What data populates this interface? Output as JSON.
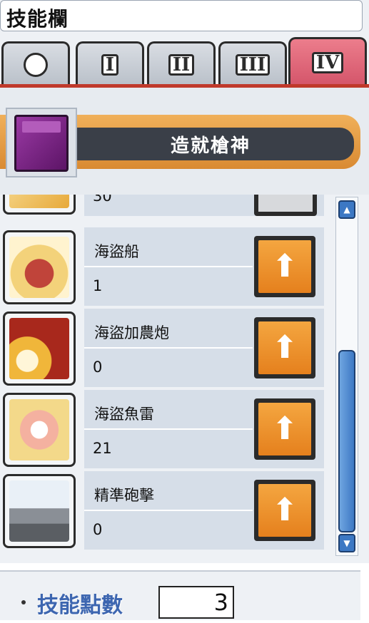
{
  "window": {
    "title": "技能欄"
  },
  "tabs": [
    {
      "label": "",
      "icon": "circle-icon",
      "active": false
    },
    {
      "label": "I",
      "active": false
    },
    {
      "label": "II",
      "active": false
    },
    {
      "label": "III",
      "active": false
    },
    {
      "label": "IV",
      "active": true
    }
  ],
  "job": {
    "name": "造就槍神",
    "icon": "purple-book-icon"
  },
  "partial_row": {
    "level": "30"
  },
  "skills": [
    {
      "name": "海盜船",
      "level": "1",
      "icon": "pirate-ship-icon"
    },
    {
      "name": "海盜加農炮",
      "level": "0",
      "icon": "cannon-icon"
    },
    {
      "name": "海盜魚雷",
      "level": "21",
      "icon": "torpedo-fish-icon"
    },
    {
      "name": "精準砲擊",
      "level": "0",
      "icon": "pirate-flag-icon"
    }
  ],
  "footer": {
    "label": "技能點數",
    "points": "3"
  },
  "colors": {
    "accent": "#d4556a",
    "level_button": "#e5801d",
    "job_banner": "#d98a32",
    "scroll": "#3d78c4"
  }
}
